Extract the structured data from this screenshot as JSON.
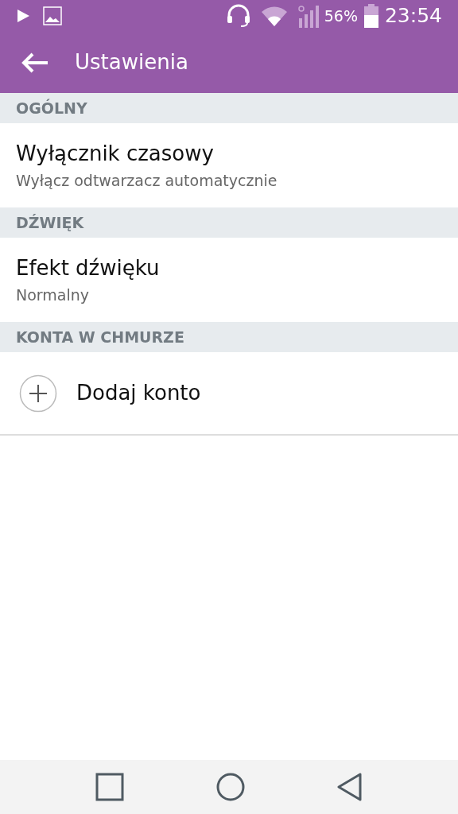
{
  "status_bar": {
    "battery": "56%",
    "time": "23:54"
  },
  "toolbar": {
    "title": "Ustawienia"
  },
  "sections": [
    {
      "header": "OGÓLNY",
      "items": [
        {
          "kind": "setting",
          "title": "Wyłącznik czasowy",
          "subtitle": "Wyłącz odtwarzacz automatycznie"
        }
      ]
    },
    {
      "header": "DŹWIĘK",
      "items": [
        {
          "kind": "setting",
          "title": "Efekt dźwięku",
          "subtitle": "Normalny"
        }
      ]
    },
    {
      "header": "KONTA W CHMURZE",
      "items": [
        {
          "kind": "add",
          "title": "Dodaj konto"
        }
      ]
    }
  ]
}
